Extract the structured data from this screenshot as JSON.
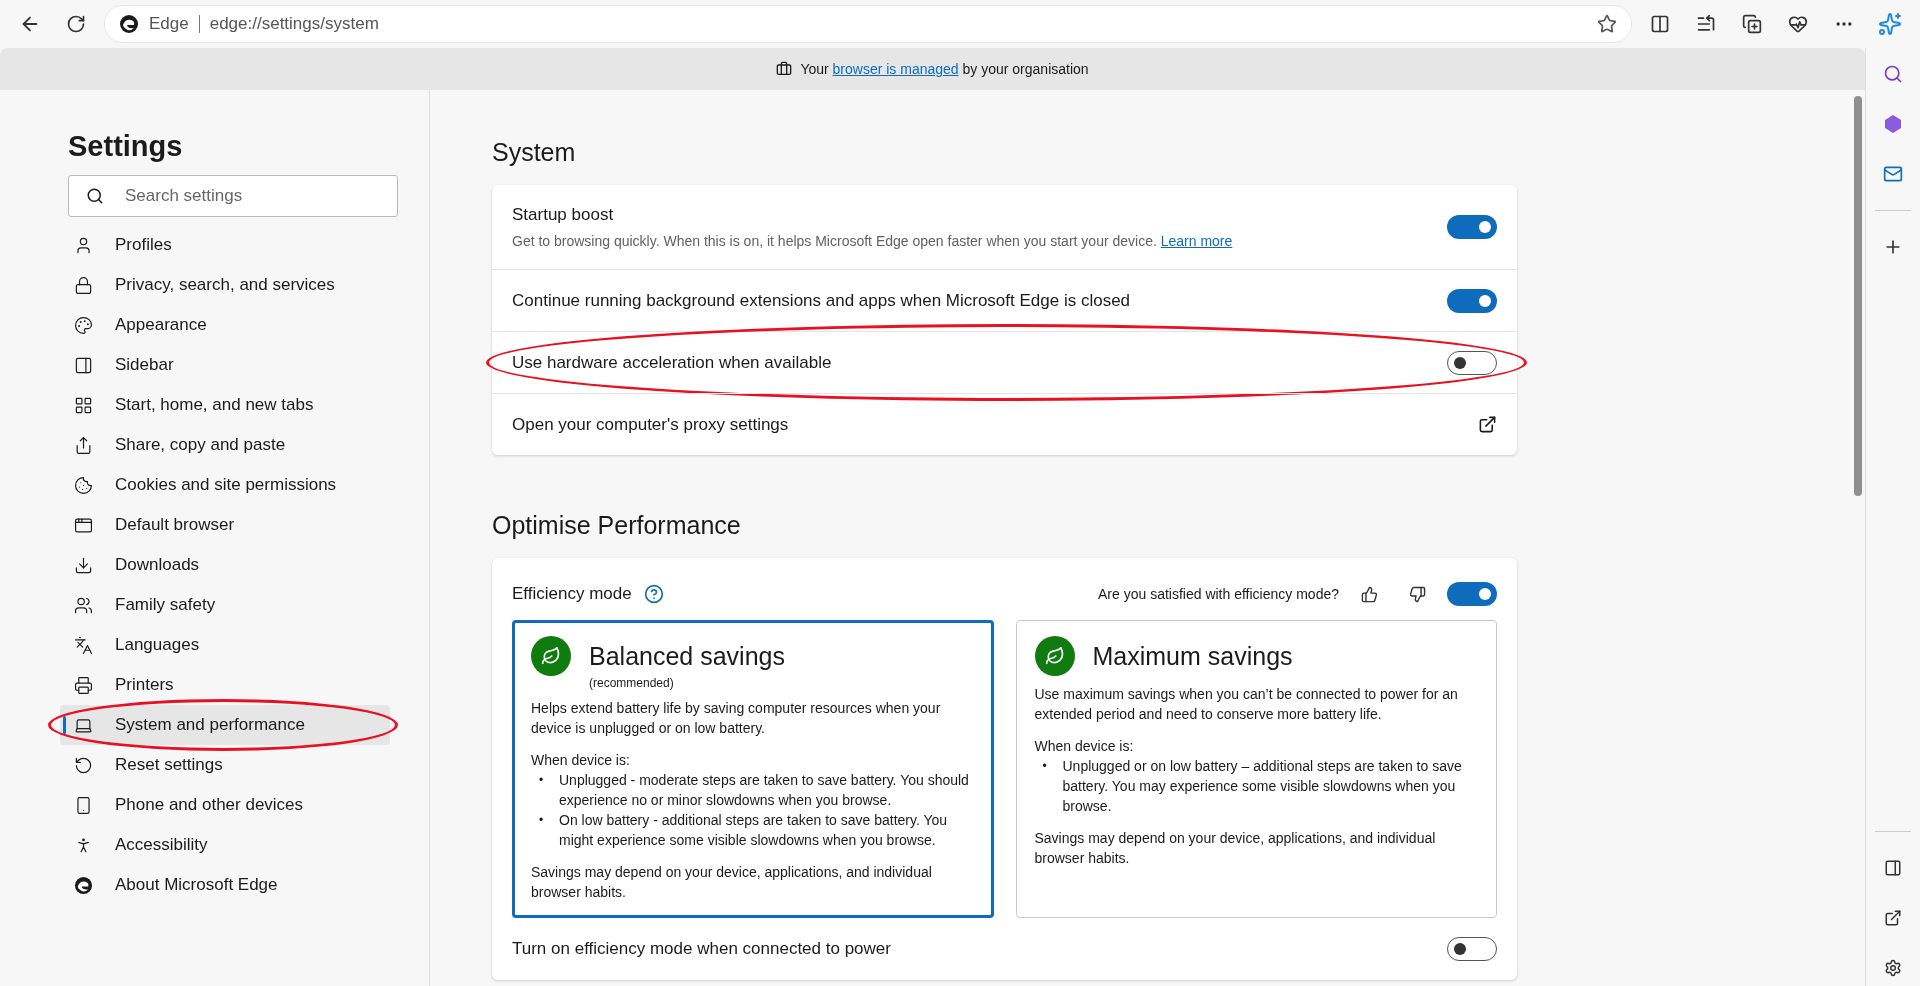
{
  "browser": {
    "address_label": "Edge",
    "url": "edge://settings/system"
  },
  "managed_bar": {
    "before": "Your",
    "link": "browser is managed",
    "after": "by your organisation"
  },
  "sidebar": {
    "title": "Settings",
    "search": {
      "placeholder": "Search settings"
    },
    "items": [
      {
        "label": "Profiles",
        "selected": false
      },
      {
        "label": "Privacy, search, and services",
        "selected": false
      },
      {
        "label": "Appearance",
        "selected": false
      },
      {
        "label": "Sidebar",
        "selected": false
      },
      {
        "label": "Start, home, and new tabs",
        "selected": false
      },
      {
        "label": "Share, copy and paste",
        "selected": false
      },
      {
        "label": "Cookies and site permissions",
        "selected": false
      },
      {
        "label": "Default browser",
        "selected": false
      },
      {
        "label": "Downloads",
        "selected": false
      },
      {
        "label": "Family safety",
        "selected": false
      },
      {
        "label": "Languages",
        "selected": false
      },
      {
        "label": "Printers",
        "selected": false
      },
      {
        "label": "System and performance",
        "selected": true,
        "annotated": true
      },
      {
        "label": "Reset settings",
        "selected": false
      },
      {
        "label": "Phone and other devices",
        "selected": false
      },
      {
        "label": "Accessibility",
        "selected": false
      },
      {
        "label": "About Microsoft Edge",
        "selected": false
      }
    ]
  },
  "system": {
    "title": "System",
    "rows": [
      {
        "kind": "toggle",
        "label": "Startup boost",
        "description": "Get to browsing quickly. When this is on, it helps Microsoft Edge open faster when you start your device.",
        "link": "Learn more",
        "on": true
      },
      {
        "kind": "toggle",
        "label": "Continue running background extensions and apps when Microsoft Edge is closed",
        "on": true
      },
      {
        "kind": "toggle",
        "label": "Use hardware acceleration when available",
        "on": false,
        "annotated": true
      },
      {
        "kind": "link",
        "label": "Open your computer's proxy settings"
      }
    ]
  },
  "performance": {
    "title": "Optimise Performance",
    "efficiency": {
      "label": "Efficiency mode",
      "feedback": "Are you satisfied with efficiency mode?",
      "on": true
    },
    "modes": [
      {
        "title": "Balanced savings",
        "subtitle": "(recommended)",
        "selected": true,
        "description": "Helps extend battery life by saving computer resources when your device is unplugged or on low battery.",
        "when": "When device is:",
        "bullet_mark": "•",
        "bullets": [
          "Unplugged - moderate steps are taken to save battery. You should experience no or minor slowdowns when you browse.",
          "On low battery - additional steps are taken to save battery. You might experience some visible slowdowns when you browse."
        ],
        "note": "Savings may depend on your device, applications, and individual browser habits."
      },
      {
        "title": "Maximum savings",
        "selected": false,
        "description": "Use maximum savings when you can’t be connected to power for an extended period and need to conserve more battery life.",
        "when": "When device is:",
        "bullet_mark": "•",
        "bullets": [
          "Unplugged or on low battery – additional steps are taken to save battery. You may experience some visible slowdowns when you browse."
        ],
        "note": "Savings may depend on your device, applications, and individual browser habits."
      }
    ],
    "power_row": {
      "label": "Turn on efficiency mode when connected to power",
      "on": false
    }
  }
}
